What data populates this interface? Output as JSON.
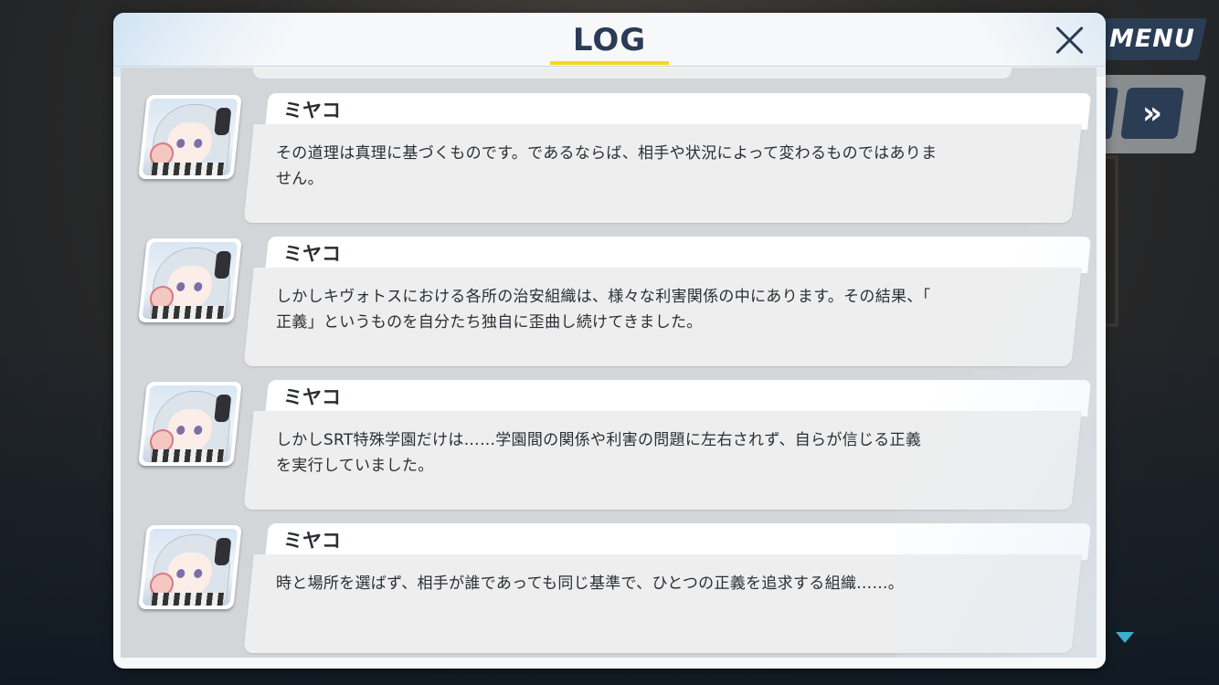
{
  "hud": {
    "menu_label": "MENU",
    "skip_icon": "fast-forward-icon",
    "scroll_icon": "triangle-down-icon"
  },
  "log": {
    "title": "LOG",
    "close_icon": "close-x-icon",
    "accent_color": "#f5d820",
    "entries": [
      {
        "speaker": "ミヤコ",
        "lines": [
          "その道理は真理に基づくものです。であるならば、相手や状況によって変わるものではありま",
          "せん。"
        ]
      },
      {
        "speaker": "ミヤコ",
        "lines": [
          "しかしキヴォトスにおける各所の治安組織は、様々な利害関係の中にあります。その結果、「",
          "正義」というものを自分たち独自に歪曲し続けてきました。"
        ]
      },
      {
        "speaker": "ミヤコ",
        "lines": [
          "しかしSRT特殊学園だけは……学園間の関係や利害の問題に左右されず、自らが信じる正義",
          "を実行していました。"
        ]
      },
      {
        "speaker": "ミヤコ",
        "lines": [
          "時と場所を選ばず、相手が誰であっても同じ基準で、ひとつの正義を追求する組織……。"
        ]
      }
    ]
  }
}
